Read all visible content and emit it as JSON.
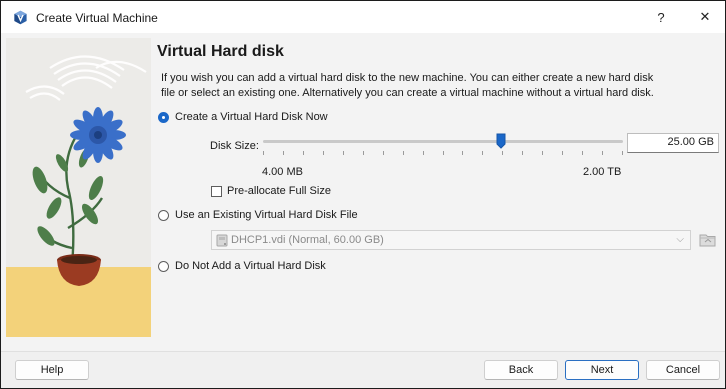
{
  "window": {
    "title": "Create Virtual Machine",
    "help_button": "?",
    "close_button": "✕"
  },
  "page": {
    "heading": "Virtual Hard disk",
    "description": "If you wish you can add a virtual hard disk to the new machine. You can either create a new hard disk file or select an existing one. Alternatively you can create a virtual machine without a virtual hard disk."
  },
  "options": {
    "create_new": {
      "label": "Create a Virtual Hard Disk Now",
      "selected": true
    },
    "use_existing": {
      "label": "Use an Existing Virtual Hard Disk File",
      "selected": false
    },
    "do_not_add": {
      "label": "Do Not Add a Virtual Hard Disk",
      "selected": false
    }
  },
  "disk_size": {
    "label": "Disk Size:",
    "value": "25.00 GB",
    "min_label": "4.00 MB",
    "max_label": "2.00 TB",
    "slider_fraction": 0.66,
    "tick_count": 18
  },
  "preallocate": {
    "label": "Pre-allocate Full Size",
    "checked": false
  },
  "existing_file": {
    "selected": "DHCP1.vdi (Normal, 60.00 GB)",
    "enabled": false
  },
  "buttons": {
    "help": "Help",
    "back": "Back",
    "next": "Next",
    "cancel": "Cancel"
  },
  "colors": {
    "accent": "#1a67c8",
    "flower": "#3a6fc9",
    "pot": "#9b3b22",
    "table": "#f3d27a"
  }
}
